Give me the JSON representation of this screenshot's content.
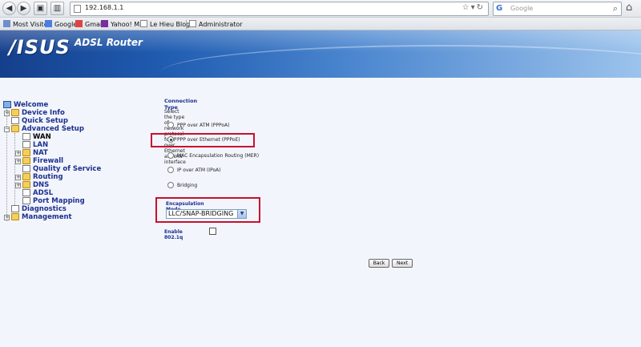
{
  "browser": {
    "url": "192.168.1.1",
    "search_placeholder": "Google",
    "bookmarks": [
      {
        "label": "Most Visited",
        "icon": "most-visited-icon"
      },
      {
        "label": "Google",
        "icon": "google-icon"
      },
      {
        "label": "Gmail!",
        "icon": "gmail-icon"
      },
      {
        "label": "Yahoo! Mail",
        "icon": "yahoo-icon"
      },
      {
        "label": "Le Hieu Blogs",
        "icon": "page-icon"
      },
      {
        "label": "Administrator",
        "icon": "page-icon"
      }
    ]
  },
  "banner": {
    "logo": "/ISUS",
    "subtitle": "ADSL Router"
  },
  "nav": {
    "items": [
      {
        "label": "Welcome",
        "icon": "monitor-icon"
      },
      {
        "label": "Device Info",
        "icon": "folder-icon"
      },
      {
        "label": "Quick Setup",
        "icon": "page-icon"
      },
      {
        "label": "Advanced Setup",
        "icon": "folder-open-icon"
      },
      {
        "label": "WAN",
        "icon": "page-icon"
      },
      {
        "label": "LAN",
        "icon": "page-icon"
      },
      {
        "label": "NAT",
        "icon": "folder-icon"
      },
      {
        "label": "Firewall",
        "icon": "folder-icon"
      },
      {
        "label": "Quality of Service",
        "icon": "page-icon"
      },
      {
        "label": "Routing",
        "icon": "folder-icon"
      },
      {
        "label": "DNS",
        "icon": "folder-icon"
      },
      {
        "label": "ADSL",
        "icon": "page-icon"
      },
      {
        "label": "Port Mapping",
        "icon": "page-icon"
      },
      {
        "label": "Diagnostics",
        "icon": "page-icon"
      },
      {
        "label": "Management",
        "icon": "folder-icon"
      }
    ]
  },
  "form": {
    "title": "Connection Type",
    "description": "Select the type of network protocol for IP over Ethernet as WAN interface",
    "options": [
      {
        "label": "PPP over ATM (PPPoA)",
        "checked": false
      },
      {
        "label": "PPP over Ethernet (PPPoE)",
        "checked": true
      },
      {
        "label": "MAC Encapsulation Routing (MER)",
        "checked": false
      },
      {
        "label": "IP over ATM (IPoA)",
        "checked": false
      },
      {
        "label": "Bridging",
        "checked": false
      }
    ],
    "encapsulation_label": "Encapsulation Mode",
    "encapsulation_value": "LLC/SNAP-BRIDGING",
    "enable_8021q_label": "Enable 802.1q",
    "enable_8021q_checked": false,
    "back_label": "Back",
    "next_label": "Next"
  },
  "colors": {
    "nav_text": "#1c2f8f",
    "highlight": "#c8102e"
  }
}
